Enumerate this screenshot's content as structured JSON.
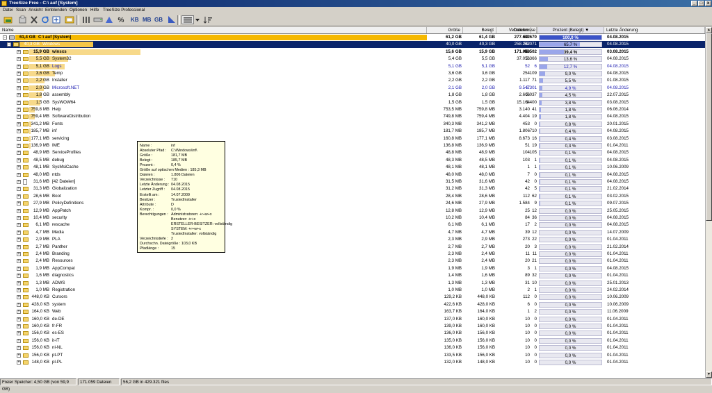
{
  "window": {
    "title": "TreeSize Free - C:\\  auf  [System]"
  },
  "menu": [
    "Datei",
    "Scan",
    "Ansicht",
    "Einblenden",
    "Optionen",
    "Hilfe",
    "TreeSize Professional"
  ],
  "toolbar": {
    "kb_label": "KB",
    "mb_label": "MB",
    "gb_label": "GB",
    "percent_label": "%"
  },
  "columns": {
    "name": "Name",
    "size": "Größe",
    "used": "Belegt",
    "files": "Dateien",
    "folders": "Verzeichnisse",
    "percent": "Prozent (Belegt)",
    "changed": "Letzte Änderung"
  },
  "colors": {
    "accent": "#f4b400",
    "selection": "#0a246a",
    "percent_fill": "#9aa6ea",
    "blue_text": "#1b1bb0"
  },
  "rows": [
    {
      "level": 0,
      "expand": "-",
      "icon": "drive",
      "prefix": "61,4 GB",
      "name": "C:\\  auf  [System]",
      "size": "61,2 GB",
      "used": "61,4 GB",
      "files": "277.632",
      "folders": "62.670",
      "pct": "100,0 %",
      "pv": 100,
      "date": "04.08.2015",
      "bar": 1.0,
      "bold": true
    },
    {
      "level": 1,
      "expand": "-",
      "icon": "folder",
      "prefix": "40,3 GB",
      "name": "Windows",
      "size": "40,0 GB",
      "used": "40,3 GB",
      "files": "258.262",
      "folders": "59.071",
      "pct": "65,7 %",
      "pv": 65.7,
      "date": "04.08.2015",
      "bar": 0.66,
      "sel": true
    },
    {
      "level": 2,
      "expand": "+",
      "icon": "folder",
      "prefix": "15,9 GB",
      "name": "winsxs",
      "size": "15,6 GB",
      "used": "15,9 GB",
      "files": "171.059",
      "folders": "48.502",
      "pct": "39,4 %",
      "pv": 39.4,
      "date": "03.08.2015",
      "bar": 1.0,
      "bold": true
    },
    {
      "level": 2,
      "expand": "+",
      "icon": "folder",
      "prefix": "5,5 GB",
      "name": "System32",
      "size": "5,4 GB",
      "used": "5,5 GB",
      "files": "37.056",
      "folders": "2.366",
      "pct": "13,6 %",
      "pv": 13.6,
      "date": "04.08.2015",
      "bar": 0.35
    },
    {
      "level": 2,
      "expand": "+",
      "icon": "folder",
      "prefix": "5,1 GB",
      "name": "Logs",
      "size": "5,1 GB",
      "used": "5,1 GB",
      "files": "52",
      "folders": "6",
      "pct": "12,7 %",
      "pv": 12.7,
      "date": "04.08.2015",
      "bar": 0.32,
      "blue": true
    },
    {
      "level": 2,
      "expand": "+",
      "icon": "folder",
      "prefix": "3,6 GB",
      "name": "Temp",
      "size": "3,6 GB",
      "used": "3,6 GB",
      "files": "254",
      "folders": "109",
      "pct": "9,0 %",
      "pv": 9.0,
      "date": "04.08.2015",
      "bar": 0.23
    },
    {
      "level": 2,
      "expand": "+",
      "icon": "folder",
      "prefix": "2,2 GB",
      "name": "Installer",
      "size": "2,2 GB",
      "used": "2,2 GB",
      "files": "1.117",
      "folders": "71",
      "pct": "5,5 %",
      "pv": 5.5,
      "date": "01.08.2015",
      "bar": 0.14
    },
    {
      "level": 2,
      "expand": "+",
      "icon": "folder",
      "prefix": "2,0 GB",
      "name": "Microsoft.NET",
      "size": "2,1 GB",
      "used": "2,0 GB",
      "files": "9.547",
      "folders": "2.301",
      "pct": "4,9 %",
      "pv": 4.9,
      "date": "04.08.2015",
      "bar": 0.13,
      "blue": true
    },
    {
      "level": 2,
      "expand": "+",
      "icon": "folder",
      "prefix": "1,8 GB",
      "name": "assembly",
      "size": "1,8 GB",
      "used": "1,8 GB",
      "files": "2.606",
      "folders": "3.037",
      "pct": "4,5 %",
      "pv": 4.5,
      "date": "22.07.2015",
      "bar": 0.11
    },
    {
      "level": 2,
      "expand": "+",
      "icon": "folder",
      "prefix": "1,5 GB",
      "name": "SysWOW64",
      "size": "1,5 GB",
      "used": "1,5 GB",
      "files": "15.164",
      "folders": "1.400",
      "pct": "3,8 %",
      "pv": 3.8,
      "date": "03.08.2015",
      "bar": 0.1
    },
    {
      "level": 2,
      "expand": "+",
      "icon": "folder",
      "prefix": "759,8 MB",
      "name": "Help",
      "size": "753,5 MB",
      "used": "759,8 MB",
      "files": "3.140",
      "folders": "41",
      "pct": "1,8 %",
      "pv": 1.8,
      "date": "06.06.2014",
      "bar": 0.05
    },
    {
      "level": 2,
      "expand": "+",
      "icon": "folder",
      "prefix": "759,4 MB",
      "name": "SoftwareDistribution",
      "size": "749,8 MB",
      "used": "759,4 MB",
      "files": "4.404",
      "folders": "19",
      "pct": "1,8 %",
      "pv": 1.8,
      "date": "04.08.2015",
      "bar": 0.05
    },
    {
      "level": 2,
      "expand": "+",
      "icon": "folder",
      "prefix": "341,2 MB",
      "name": "Fonts",
      "size": "340,3 MB",
      "used": "341,2 MB",
      "files": "453",
      "folders": "0",
      "pct": "0,8 %",
      "pv": 0.8,
      "date": "20.01.2015",
      "bar": 0.02
    },
    {
      "level": 2,
      "expand": "+",
      "icon": "folder",
      "prefix": "185,7 MB",
      "name": "inf",
      "size": "181,7 MB",
      "used": "185,7 MB",
      "files": "1.806",
      "folders": "710",
      "pct": "0,4 %",
      "pv": 0.4,
      "date": "04.08.2015",
      "bar": 0.01
    },
    {
      "level": 2,
      "expand": "+",
      "icon": "folder",
      "prefix": "177,1 MB",
      "name": "servicing",
      "size": "160,8 MB",
      "used": "177,1 MB",
      "files": "8.673",
      "folders": "16",
      "pct": "0,4 %",
      "pv": 0.4,
      "date": "03.08.2015",
      "bar": 0.01
    },
    {
      "level": 2,
      "expand": "+",
      "icon": "folder",
      "prefix": "136,9 MB",
      "name": "IME",
      "size": "136,8 MB",
      "used": "136,9 MB",
      "files": "51",
      "folders": "19",
      "pct": "0,3 %",
      "pv": 0.3,
      "date": "01.04.2011",
      "bar": 0.01
    },
    {
      "level": 2,
      "expand": "+",
      "icon": "folder",
      "prefix": "48,9 MB",
      "name": "ServiceProfiles",
      "size": "48,8 MB",
      "used": "48,9 MB",
      "files": "104",
      "folders": "105",
      "pct": "0,1 %",
      "pv": 0.1,
      "date": "04.08.2015",
      "bar": 0.0
    },
    {
      "level": 2,
      "expand": "+",
      "icon": "folder",
      "prefix": "48,5 MB",
      "name": "debug",
      "size": "48,3 MB",
      "used": "48,5 MB",
      "files": "103",
      "folders": "1",
      "pct": "0,1 %",
      "pv": 0.1,
      "date": "04.08.2015",
      "bar": 0.0
    },
    {
      "level": 2,
      "expand": "+",
      "icon": "folder",
      "prefix": "48,1 MB",
      "name": "SysMsiCache",
      "size": "48,1 MB",
      "used": "48,1 MB",
      "files": "1",
      "folders": "1",
      "pct": "0,1 %",
      "pv": 0.1,
      "date": "10.06.2009",
      "bar": 0.0
    },
    {
      "level": 2,
      "expand": "+",
      "icon": "folder",
      "prefix": "48,0 MB",
      "name": "ntds",
      "size": "48,0 MB",
      "used": "48,0 MB",
      "files": "7",
      "folders": "0",
      "pct": "0,1 %",
      "pv": 0.1,
      "date": "04.08.2015",
      "bar": 0.0
    },
    {
      "level": 2,
      "expand": "+",
      "icon": "file",
      "prefix": "31,6 MB",
      "name": "[42 Dateien]",
      "size": "31,5 MB",
      "used": "31,6 MB",
      "files": "42",
      "folders": "0",
      "pct": "0,1 %",
      "pv": 0.1,
      "date": "04.08.2015",
      "bar": 0.0
    },
    {
      "level": 2,
      "expand": "+",
      "icon": "folder",
      "prefix": "31,3 MB",
      "name": "Globalization",
      "size": "31,2 MB",
      "used": "31,3 MB",
      "files": "42",
      "folders": "5",
      "pct": "0,1 %",
      "pv": 0.1,
      "date": "21.02.2014",
      "bar": 0.0
    },
    {
      "level": 2,
      "expand": "+",
      "icon": "folder",
      "prefix": "28,6 MB",
      "name": "Boot",
      "size": "28,4 MB",
      "used": "28,6 MB",
      "files": "112",
      "folders": "62",
      "pct": "0,1 %",
      "pv": 0.1,
      "date": "03.02.2015",
      "bar": 0.0
    },
    {
      "level": 2,
      "expand": "+",
      "icon": "folder",
      "prefix": "27,9 MB",
      "name": "PolicyDefinitions",
      "size": "24,6 MB",
      "used": "27,9 MB",
      "files": "1.584",
      "folders": "9",
      "pct": "0,1 %",
      "pv": 0.1,
      "date": "09.07.2015",
      "bar": 0.0
    },
    {
      "level": 2,
      "expand": "+",
      "icon": "folder",
      "prefix": "12,9 MB",
      "name": "AppPatch",
      "size": "12,8 MB",
      "used": "12,9 MB",
      "files": "25",
      "folders": "12",
      "pct": "0,0 %",
      "pv": 0.0,
      "date": "25.05.2015",
      "bar": 0.0
    },
    {
      "level": 2,
      "expand": "+",
      "icon": "folder",
      "prefix": "10,4 MB",
      "name": "security",
      "size": "10,2 MB",
      "used": "10,4 MB",
      "files": "84",
      "folders": "36",
      "pct": "0,0 %",
      "pv": 0.0,
      "date": "04.08.2015",
      "bar": 0.0
    },
    {
      "level": 2,
      "expand": "+",
      "icon": "folder",
      "prefix": "6,1 MB",
      "name": "rescache",
      "size": "6,1 MB",
      "used": "6,1 MB",
      "files": "17",
      "folders": "2",
      "pct": "0,0 %",
      "pv": 0.0,
      "date": "04.08.2015",
      "bar": 0.0
    },
    {
      "level": 2,
      "expand": "+",
      "icon": "folder",
      "prefix": "4,7 MB",
      "name": "Media",
      "size": "4,7 MB",
      "used": "4,7 MB",
      "files": "39",
      "folders": "12",
      "pct": "0,0 %",
      "pv": 0.0,
      "date": "14.07.2009",
      "bar": 0.0
    },
    {
      "level": 2,
      "expand": "+",
      "icon": "folder",
      "prefix": "2,9 MB",
      "name": "PLA",
      "size": "2,3 MB",
      "used": "2,9 MB",
      "files": "273",
      "folders": "22",
      "pct": "0,0 %",
      "pv": 0.0,
      "date": "01.04.2011",
      "bar": 0.0
    },
    {
      "level": 2,
      "expand": "+",
      "icon": "folder",
      "prefix": "2,7 MB",
      "name": "Panther",
      "size": "2,7 MB",
      "used": "2,7 MB",
      "files": "20",
      "folders": "3",
      "pct": "0,0 %",
      "pv": 0.0,
      "date": "21.02.2014",
      "bar": 0.0
    },
    {
      "level": 2,
      "expand": "+",
      "icon": "folder",
      "prefix": "2,4 MB",
      "name": "Branding",
      "size": "2,3 MB",
      "used": "2,4 MB",
      "files": "11",
      "folders": "11",
      "pct": "0,0 %",
      "pv": 0.0,
      "date": "01.04.2011",
      "bar": 0.0
    },
    {
      "level": 2,
      "expand": "+",
      "icon": "folder",
      "prefix": "2,4 MB",
      "name": "Resources",
      "size": "2,3 MB",
      "used": "2,4 MB",
      "files": "20",
      "folders": "21",
      "pct": "0,0 %",
      "pv": 0.0,
      "date": "01.04.2011",
      "bar": 0.0
    },
    {
      "level": 2,
      "expand": "+",
      "icon": "folder",
      "prefix": "1,9 MB",
      "name": "AppCompat",
      "size": "1,9 MB",
      "used": "1,9 MB",
      "files": "3",
      "folders": "1",
      "pct": "0,0 %",
      "pv": 0.0,
      "date": "04.08.2015",
      "bar": 0.0
    },
    {
      "level": 2,
      "expand": "+",
      "icon": "folder",
      "prefix": "1,6 MB",
      "name": "diagnostics",
      "size": "1,4 MB",
      "used": "1,6 MB",
      "files": "89",
      "folders": "32",
      "pct": "0,0 %",
      "pv": 0.0,
      "date": "01.04.2011",
      "bar": 0.0
    },
    {
      "level": 2,
      "expand": "+",
      "icon": "folder",
      "prefix": "1,3 MB",
      "name": "ADWS",
      "size": "1,3 MB",
      "used": "1,3 MB",
      "files": "31",
      "folders": "10",
      "pct": "0,0 %",
      "pv": 0.0,
      "date": "25.01.2013",
      "bar": 0.0
    },
    {
      "level": 2,
      "expand": "+",
      "icon": "folder",
      "prefix": "1,0 MB",
      "name": "Registration",
      "size": "1,0 MB",
      "used": "1,0 MB",
      "files": "2",
      "folders": "1",
      "pct": "0,0 %",
      "pv": 0.0,
      "date": "24.02.2014",
      "bar": 0.0
    },
    {
      "level": 2,
      "expand": "+",
      "icon": "folder",
      "prefix": "448,0 KB",
      "name": "Cursors",
      "size": "129,2 KB",
      "used": "448,0 KB",
      "files": "112",
      "folders": "0",
      "pct": "0,0 %",
      "pv": 0.0,
      "date": "10.06.2009",
      "bar": 0.0
    },
    {
      "level": 2,
      "expand": "+",
      "icon": "folder",
      "prefix": "428,0 KB",
      "name": "system",
      "size": "422,6 KB",
      "used": "428,0 KB",
      "files": "6",
      "folders": "0",
      "pct": "0,0 %",
      "pv": 0.0,
      "date": "10.06.2009",
      "bar": 0.0
    },
    {
      "level": 2,
      "expand": "+",
      "icon": "folder",
      "prefix": "164,0 KB",
      "name": "Web",
      "size": "163,7 KB",
      "used": "164,0 KB",
      "files": "1",
      "folders": "2",
      "pct": "0,0 %",
      "pv": 0.0,
      "date": "11.06.2009",
      "bar": 0.0
    },
    {
      "level": 2,
      "expand": "+",
      "icon": "folder",
      "prefix": "160,0 KB",
      "name": "de-DE",
      "size": "137,0 KB",
      "used": "160,0 KB",
      "files": "10",
      "folders": "0",
      "pct": "0,0 %",
      "pv": 0.0,
      "date": "01.04.2011",
      "bar": 0.0
    },
    {
      "level": 2,
      "expand": "+",
      "icon": "folder",
      "prefix": "160,0 KB",
      "name": "fr-FR",
      "size": "139,0 KB",
      "used": "160,0 KB",
      "files": "10",
      "folders": "0",
      "pct": "0,0 %",
      "pv": 0.0,
      "date": "01.04.2011",
      "bar": 0.0
    },
    {
      "level": 2,
      "expand": "+",
      "icon": "folder",
      "prefix": "156,0 KB",
      "name": "es-ES",
      "size": "136,0 KB",
      "used": "156,0 KB",
      "files": "10",
      "folders": "0",
      "pct": "0,0 %",
      "pv": 0.0,
      "date": "01.04.2011",
      "bar": 0.0
    },
    {
      "level": 2,
      "expand": "+",
      "icon": "folder",
      "prefix": "156,0 KB",
      "name": "it-IT",
      "size": "135,0 KB",
      "used": "156,0 KB",
      "files": "10",
      "folders": "0",
      "pct": "0,0 %",
      "pv": 0.0,
      "date": "01.04.2011",
      "bar": 0.0
    },
    {
      "level": 2,
      "expand": "+",
      "icon": "folder",
      "prefix": "156,0 KB",
      "name": "nl-NL",
      "size": "136,0 KB",
      "used": "156,0 KB",
      "files": "10",
      "folders": "0",
      "pct": "0,0 %",
      "pv": 0.0,
      "date": "01.04.2011",
      "bar": 0.0
    },
    {
      "level": 2,
      "expand": "+",
      "icon": "folder",
      "prefix": "156,0 KB",
      "name": "pt-PT",
      "size": "133,5 KB",
      "used": "156,0 KB",
      "files": "10",
      "folders": "0",
      "pct": "0,0 %",
      "pv": 0.0,
      "date": "01.04.2011",
      "bar": 0.0
    },
    {
      "level": 2,
      "expand": "+",
      "icon": "folder",
      "prefix": "148,0 KB",
      "name": "pl-PL",
      "size": "132,0 KB",
      "used": "148,0 KB",
      "files": "10",
      "folders": "0",
      "pct": "0,0 %",
      "pv": 0.0,
      "date": "01.04.2011",
      "bar": 0.0
    }
  ],
  "tooltip": [
    {
      "label": "Name :",
      "value": "inf"
    },
    {
      "label": "Absoluter Pfad :",
      "value": "C:\\Windows\\inf\\"
    },
    {
      "label": "Größe :",
      "value": "181,7 MB"
    },
    {
      "label": "Belegt :",
      "value": "185,7 MB"
    },
    {
      "label": "Prozent :",
      "value": "0,4 %"
    },
    {
      "label": "Größe auf optischen Medien : 185,3 MB",
      "value": ""
    },
    {
      "label": "Dateien :",
      "value": "1.806 Dateien"
    },
    {
      "label": "Verzeichnisse :",
      "value": "710"
    },
    {
      "label": "Letzte Änderung :",
      "value": "04.08.2015"
    },
    {
      "label": "Letzter Zugriff :",
      "value": "04.08.2015"
    },
    {
      "label": "Erstellt am :",
      "value": "14.07.2009"
    },
    {
      "label": "Besitzer :",
      "value": "TrustedInstaller"
    },
    {
      "label": "Attribute :",
      "value": "D"
    },
    {
      "label": "Kompr. :",
      "value": "0,0 %"
    },
    {
      "label": "Berechtigungen :",
      "value": "Administratoren: +r+w+x"
    },
    {
      "label": "",
      "value": "Benutzer: +r+x"
    },
    {
      "label": "",
      "value": "ERSTELLER-BESITZER: vollständig"
    },
    {
      "label": "",
      "value": "SYSTEM: +r+w+x"
    },
    {
      "label": "",
      "value": "TrustedInstaller: vollständig"
    },
    {
      "label": "Verzeichnistiefe :",
      "value": "2"
    },
    {
      "label": "Durchschn. Dateigröße : 103,0 KB",
      "value": ""
    },
    {
      "label": "Pfadlänge :",
      "value": "15"
    }
  ],
  "status": {
    "free": "Freier Speicher: 4,50 GB  (von 59,9 GB)",
    "files": "171.059  Dateien",
    "total": "56,2 GB in 429.321 files"
  }
}
